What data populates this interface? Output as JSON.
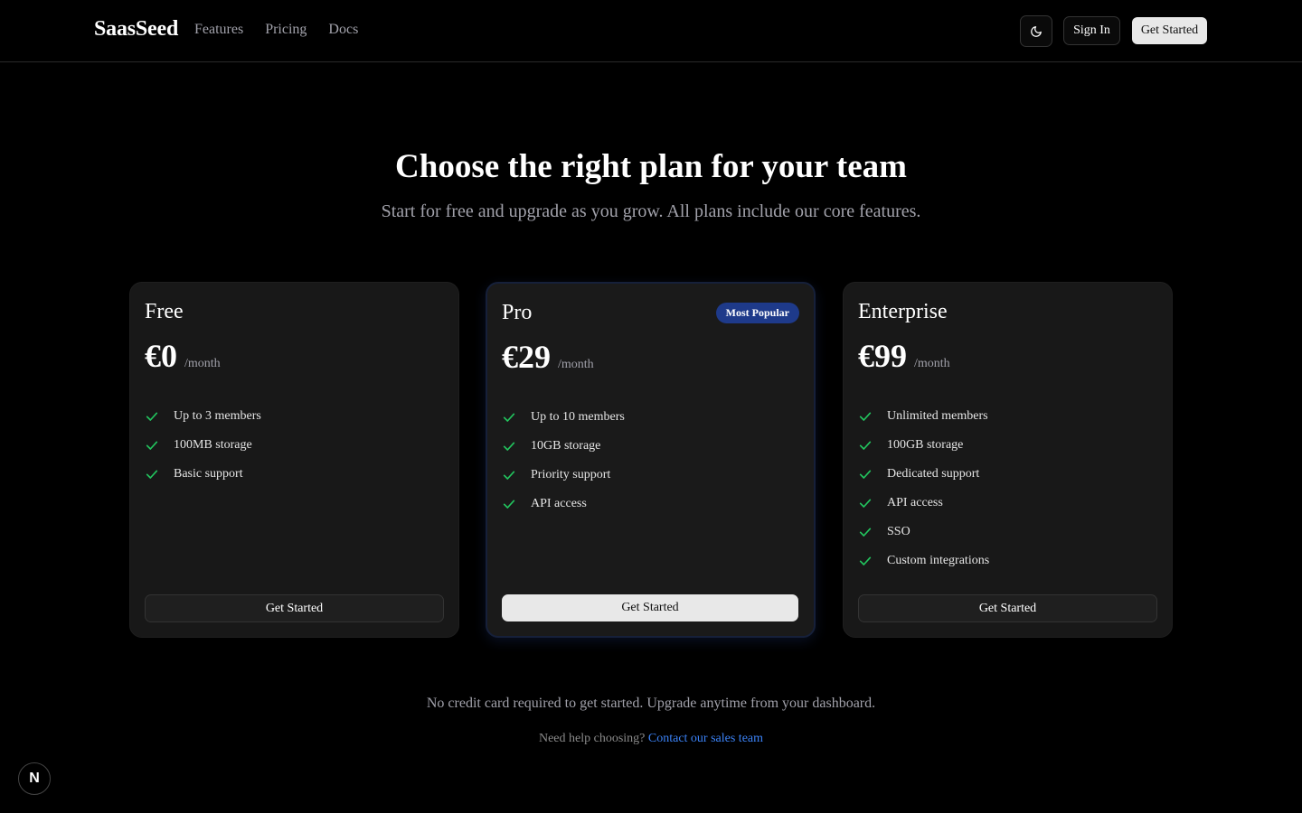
{
  "nav": {
    "brand": "SaasSeed",
    "links": [
      "Features",
      "Pricing",
      "Docs"
    ],
    "theme_icon": "moon-icon",
    "sign_in": "Sign In",
    "get_started": "Get Started"
  },
  "hero": {
    "title": "Choose the right plan for your team",
    "subtitle": "Start for free and upgrade as you grow. All plans include our core features."
  },
  "plans": [
    {
      "name": "Free",
      "price": "€0",
      "period": "/month",
      "features": [
        "Up to 3 members",
        "100MB storage",
        "Basic support"
      ],
      "cta": "Get Started"
    },
    {
      "name": "Pro",
      "badge": "Most Popular",
      "price": "€29",
      "period": "/month",
      "features": [
        "Up to 10 members",
        "10GB storage",
        "Priority support",
        "API access"
      ],
      "cta": "Get Started"
    },
    {
      "name": "Enterprise",
      "price": "€99",
      "period": "/month",
      "features": [
        "Unlimited members",
        "100GB storage",
        "Dedicated support",
        "API access",
        "SSO",
        "Custom integrations"
      ],
      "cta": "Get Started"
    }
  ],
  "footer": {
    "note": "No credit card required to get started. Upgrade anytime from your dashboard.",
    "help_prefix": "Need help choosing?",
    "help_link": "Contact our sales team"
  },
  "dev_badge": {
    "icon": "next-logo-icon",
    "text": "N"
  },
  "colors": {
    "background": "#000000",
    "card": "#181818",
    "accent_badge": "#1e3a8a",
    "check": "#22c55e",
    "link": "#3b82f6"
  }
}
